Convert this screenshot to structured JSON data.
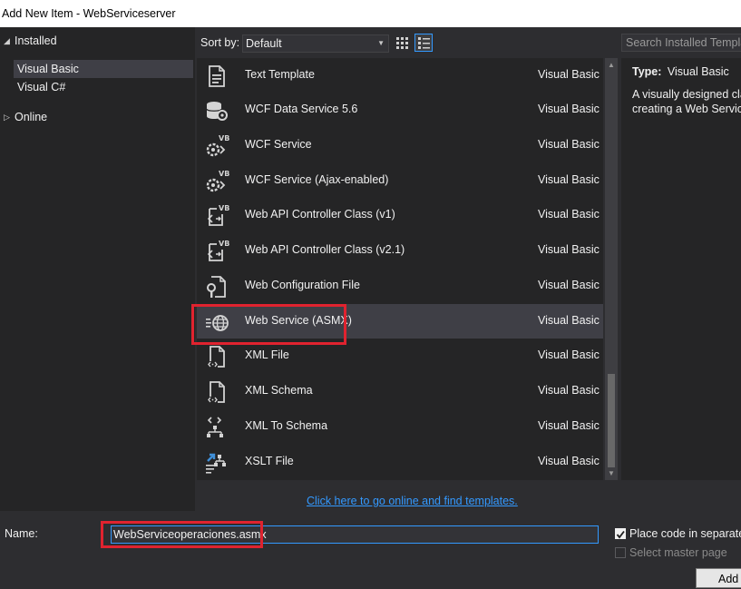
{
  "window": {
    "title": "Add New Item - WebServiceserver"
  },
  "tree": {
    "installed": "Installed",
    "visual_basic": "Visual Basic",
    "visual_csharp": "Visual C#",
    "online": "Online"
  },
  "toolbar": {
    "sort_label": "Sort by:",
    "sort_value": "Default"
  },
  "search": {
    "placeholder": "Search Installed Templates"
  },
  "templates": [
    {
      "name": "Text Template",
      "lang": "Visual Basic",
      "icon": "text-template-icon"
    },
    {
      "name": "WCF Data Service 5.6",
      "lang": "Visual Basic",
      "icon": "wcf-data-service-icon"
    },
    {
      "name": "WCF Service",
      "lang": "Visual Basic",
      "icon": "wcf-service-icon"
    },
    {
      "name": "WCF Service (Ajax-enabled)",
      "lang": "Visual Basic",
      "icon": "wcf-service-ajax-icon"
    },
    {
      "name": "Web API Controller Class (v1)",
      "lang": "Visual Basic",
      "icon": "web-api-controller-icon"
    },
    {
      "name": "Web API Controller Class (v2.1)",
      "lang": "Visual Basic",
      "icon": "web-api-controller-icon"
    },
    {
      "name": "Web Configuration File",
      "lang": "Visual Basic",
      "icon": "web-config-icon"
    },
    {
      "name": "Web Service (ASMX)",
      "lang": "Visual Basic",
      "icon": "web-service-globe-icon"
    },
    {
      "name": "XML File",
      "lang": "Visual Basic",
      "icon": "xml-file-icon"
    },
    {
      "name": "XML Schema",
      "lang": "Visual Basic",
      "icon": "xml-schema-icon"
    },
    {
      "name": "XML To Schema",
      "lang": "Visual Basic",
      "icon": "xml-to-schema-icon"
    },
    {
      "name": "XSLT File",
      "lang": "Visual Basic",
      "icon": "xslt-file-icon"
    }
  ],
  "details": {
    "type_label": "Type:",
    "type_value": "Visual Basic",
    "description": "A visually designed class for creating a Web Service"
  },
  "online_link": "Click here to go online and find templates.",
  "name_field": {
    "label": "Name:",
    "value": "WebServiceoperaciones.asmx"
  },
  "options": {
    "place_code": "Place code in separate file",
    "select_master": "Select master page"
  },
  "buttons": {
    "add": "Add"
  }
}
